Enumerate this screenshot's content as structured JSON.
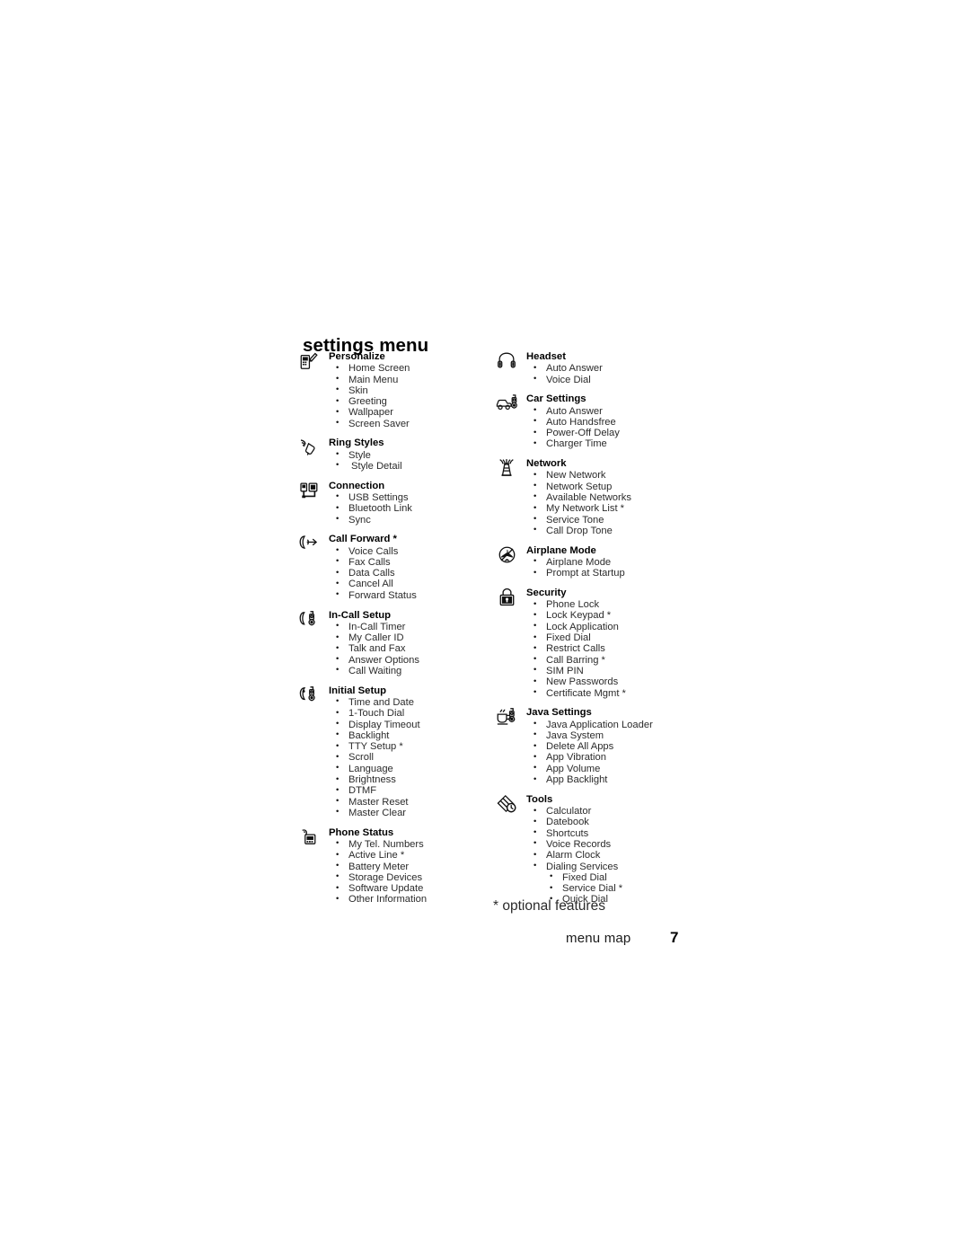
{
  "page": {
    "title": "settings menu",
    "footnote": "* optional features",
    "footer_label": "menu map",
    "folio": "7"
  },
  "columns": [
    {
      "name": "left-column",
      "groups": [
        {
          "icon": "phone-pencil-icon",
          "heading": "Personalize",
          "items": [
            {
              "label": "Home Screen"
            },
            {
              "label": "Main Menu"
            },
            {
              "label": "Skin"
            },
            {
              "label": "Greeting"
            },
            {
              "label": "Wallpaper"
            },
            {
              "label": "Screen Saver"
            }
          ]
        },
        {
          "icon": "ring-styles-icon",
          "heading": "Ring Styles",
          "items": [
            {
              "label": "Style"
            },
            {
              "label": "Style Detail",
              "pad": true
            }
          ]
        },
        {
          "icon": "connection-icon",
          "heading": "Connection",
          "items": [
            {
              "label": "USB Settings"
            },
            {
              "label": "Bluetooth Link"
            },
            {
              "label": "Sync"
            }
          ]
        },
        {
          "icon": "call-forward-icon",
          "heading": "Call Forward *",
          "items": [
            {
              "label": "Voice Calls"
            },
            {
              "label": "Fax Calls"
            },
            {
              "label": "Data Calls"
            },
            {
              "label": "Cancel All"
            },
            {
              "label": "Forward Status"
            }
          ]
        },
        {
          "icon": "in-call-setup-icon",
          "heading": "In-Call Setup",
          "items": [
            {
              "label": "In-Call Timer"
            },
            {
              "label": "My Caller ID"
            },
            {
              "label": "Talk and Fax"
            },
            {
              "label": "Answer Options"
            },
            {
              "label": "Call Waiting"
            }
          ]
        },
        {
          "icon": "initial-setup-icon",
          "heading": "Initial Setup",
          "items": [
            {
              "label": "Time and Date"
            },
            {
              "label": "1-Touch Dial"
            },
            {
              "label": "Display Timeout"
            },
            {
              "label": "Backlight"
            },
            {
              "label": "TTY Setup *"
            },
            {
              "label": "Scroll"
            },
            {
              "label": "Language"
            },
            {
              "label": "Brightness"
            },
            {
              "label": "DTMF"
            },
            {
              "label": "Master Reset"
            },
            {
              "label": "Master Clear"
            }
          ]
        },
        {
          "icon": "phone-status-icon",
          "heading": "Phone Status",
          "items": [
            {
              "label": "My Tel. Numbers"
            },
            {
              "label": "Active Line *"
            },
            {
              "label": "Battery Meter"
            },
            {
              "label": "Storage Devices"
            },
            {
              "label": "Software Update"
            },
            {
              "label": "Other Information"
            }
          ]
        }
      ]
    },
    {
      "name": "right-column",
      "groups": [
        {
          "icon": "headset-icon",
          "heading": "Headset",
          "items": [
            {
              "label": "Auto Answer"
            },
            {
              "label": "Voice Dial"
            }
          ]
        },
        {
          "icon": "car-settings-icon",
          "heading": "Car Settings",
          "items": [
            {
              "label": "Auto Answer"
            },
            {
              "label": "Auto Handsfree"
            },
            {
              "label": "Power-Off Delay"
            },
            {
              "label": "Charger Time"
            }
          ]
        },
        {
          "icon": "network-antenna-icon",
          "heading": "Network",
          "items": [
            {
              "label": "New Network"
            },
            {
              "label": "Network Setup"
            },
            {
              "label": "Available Networks"
            },
            {
              "label": "My Network List *"
            },
            {
              "label": "Service Tone"
            },
            {
              "label": "Call Drop Tone"
            }
          ]
        },
        {
          "icon": "airplane-mode-icon",
          "heading": "Airplane Mode",
          "items": [
            {
              "label": "Airplane Mode"
            },
            {
              "label": "Prompt at Startup"
            }
          ]
        },
        {
          "icon": "security-lock-icon",
          "heading": "Security",
          "items": [
            {
              "label": "Phone Lock"
            },
            {
              "label": "Lock Keypad *"
            },
            {
              "label": "Lock Application"
            },
            {
              "label": "Fixed Dial"
            },
            {
              "label": "Restrict Calls"
            },
            {
              "label": "Call Barring *"
            },
            {
              "label": "SIM PIN"
            },
            {
              "label": "New Passwords"
            },
            {
              "label": "Certificate Mgmt *"
            }
          ]
        },
        {
          "icon": "java-settings-icon",
          "heading": "Java Settings",
          "items": [
            {
              "label": "Java Application Loader"
            },
            {
              "label": "Java System"
            },
            {
              "label": "Delete All Apps"
            },
            {
              "label": "App Vibration"
            },
            {
              "label": "App Volume"
            },
            {
              "label": "App Backlight"
            }
          ]
        },
        {
          "icon": "tools-icon",
          "heading": "Tools",
          "items": [
            {
              "label": "Calculator"
            },
            {
              "label": "Datebook"
            },
            {
              "label": "Shortcuts"
            },
            {
              "label": "Voice Records"
            },
            {
              "label": "Alarm Clock"
            },
            {
              "label": "Dialing Services"
            },
            {
              "label": "Fixed Dial",
              "sub": true
            },
            {
              "label": "Service Dial *",
              "sub": true
            },
            {
              "label": "Quick Dial",
              "sub": true
            }
          ]
        }
      ]
    }
  ]
}
